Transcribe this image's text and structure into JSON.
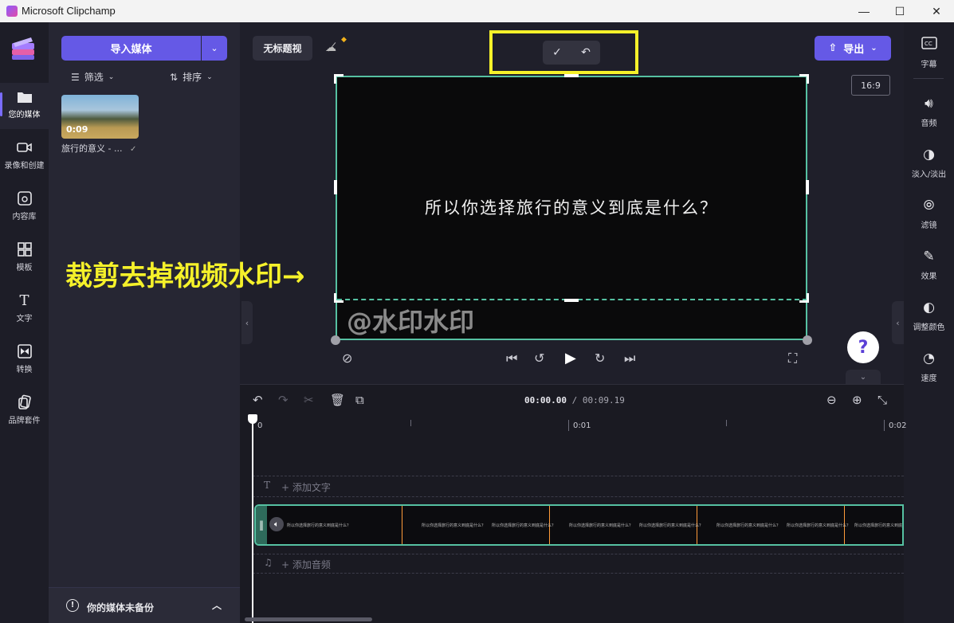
{
  "window": {
    "title": "Microsoft Clipchamp",
    "minimize": "—",
    "maximize": "☐",
    "close": "✕"
  },
  "left_nav": [
    {
      "label": "您的媒体",
      "icon": "folder-icon",
      "active": true
    },
    {
      "label": "录像和创建",
      "icon": "camera-icon"
    },
    {
      "label": "内容库",
      "icon": "library-icon"
    },
    {
      "label": "模板",
      "icon": "template-icon"
    },
    {
      "label": "文字",
      "icon": "text-icon"
    },
    {
      "label": "转换",
      "icon": "transition-icon"
    },
    {
      "label": "品牌套件",
      "icon": "brand-icon"
    }
  ],
  "media_panel": {
    "import_label": "导入媒体",
    "filter_label": "筛选",
    "sort_label": "排序",
    "item": {
      "duration": "0:09",
      "name": "旅行的意义 - ..."
    },
    "backup_text": "你的媒体未备份"
  },
  "stage": {
    "project_title": "无标题视",
    "export_label": "导出",
    "aspect_ratio": "16:9",
    "caption": "所以你选择旅行的意义到底是什么？",
    "watermark": "@水印水印",
    "annotation": "裁剪去掉视频水印→",
    "help": "?"
  },
  "right_nav": [
    {
      "label": "字幕",
      "icon": "captions-icon"
    },
    {
      "label": "音频",
      "icon": "speaker-icon"
    },
    {
      "label": "淡入/淡出",
      "icon": "fade-icon"
    },
    {
      "label": "滤镜",
      "icon": "filter-icon"
    },
    {
      "label": "效果",
      "icon": "magic-wand-icon"
    },
    {
      "label": "调整颜色",
      "icon": "color-adjust-icon"
    },
    {
      "label": "速度",
      "icon": "speed-icon"
    }
  ],
  "timeline": {
    "current_time": "00:00.00",
    "total_time": "/ 00:09.19",
    "ruler": [
      "0",
      "0:01",
      "0:02"
    ],
    "add_text": "+ 添加文字",
    "add_audio": "+ 添加音频",
    "frame_caption": "所以你选择旅行的意义到底是什么？"
  },
  "colors": {
    "accent": "#6559e6",
    "crop": "#56c1a2",
    "annotation": "#f5f12a"
  }
}
